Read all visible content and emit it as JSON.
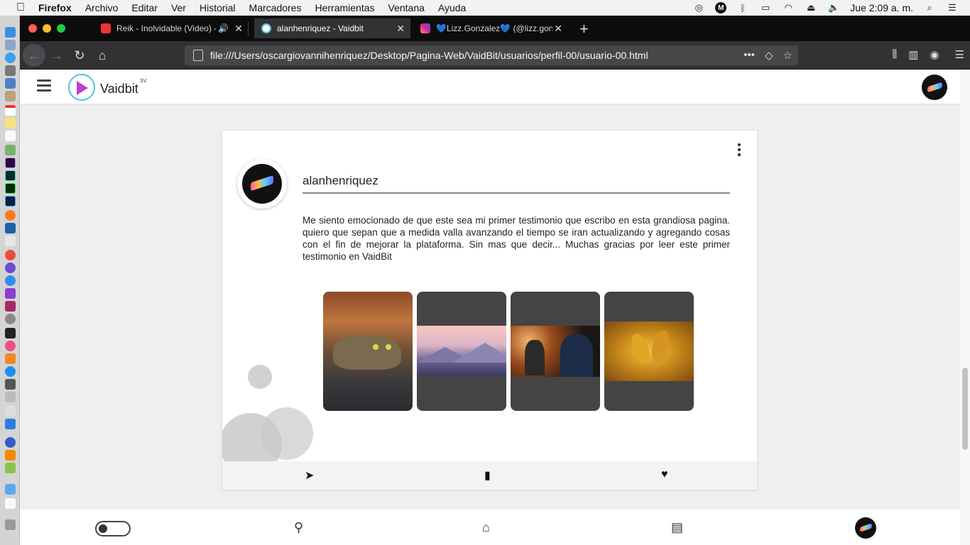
{
  "menubar": {
    "app_name": "Firefox",
    "items": [
      "Archivo",
      "Editar",
      "Ver",
      "Historial",
      "Marcadores",
      "Herramientas",
      "Ventana",
      "Ayuda"
    ],
    "clock": "Jue 2:09 a. m."
  },
  "tabs": [
    {
      "title": "Reik - Inolvidable (Video) - ",
      "favicon": "youtube-icon",
      "audio": true
    },
    {
      "title": "alanhenriquez - Vaidbit",
      "favicon": "vaidbit-icon",
      "active": true
    },
    {
      "title": "💙Lizz.Gonzalez💙 (@lizz.gonz",
      "favicon": "instagram-icon"
    }
  ],
  "urlbar": {
    "url": "file:///Users/oscargiovannihenriquez/Desktop/Pagina-Web/VaidBit/usuarios/perfil-00/usuario-00.html"
  },
  "app": {
    "brand": "Vaidbit",
    "brand_sup": "SV"
  },
  "post": {
    "username": "alanhenriquez",
    "text": "Me siento emocionado de que este sea mi primer testimonio que escribo en esta grandiosa pagina. quiero que sepan que a medida valla avanzando el tiempo se iran actualizando y agregando cosas con el fin de mejorar la plataforma. Sin mas que decir... Muchas gracias por leer este primer testimonio en VaidBit",
    "images": [
      "cat",
      "mountains",
      "concert",
      "autumn-leaves"
    ]
  },
  "colors": {
    "firefox_dark": "#0c0c0d",
    "toolbar": "#323234",
    "page_bg": "#efefef",
    "accent_cyan": "#52c1de",
    "accent_purple": "#c33fd1"
  }
}
